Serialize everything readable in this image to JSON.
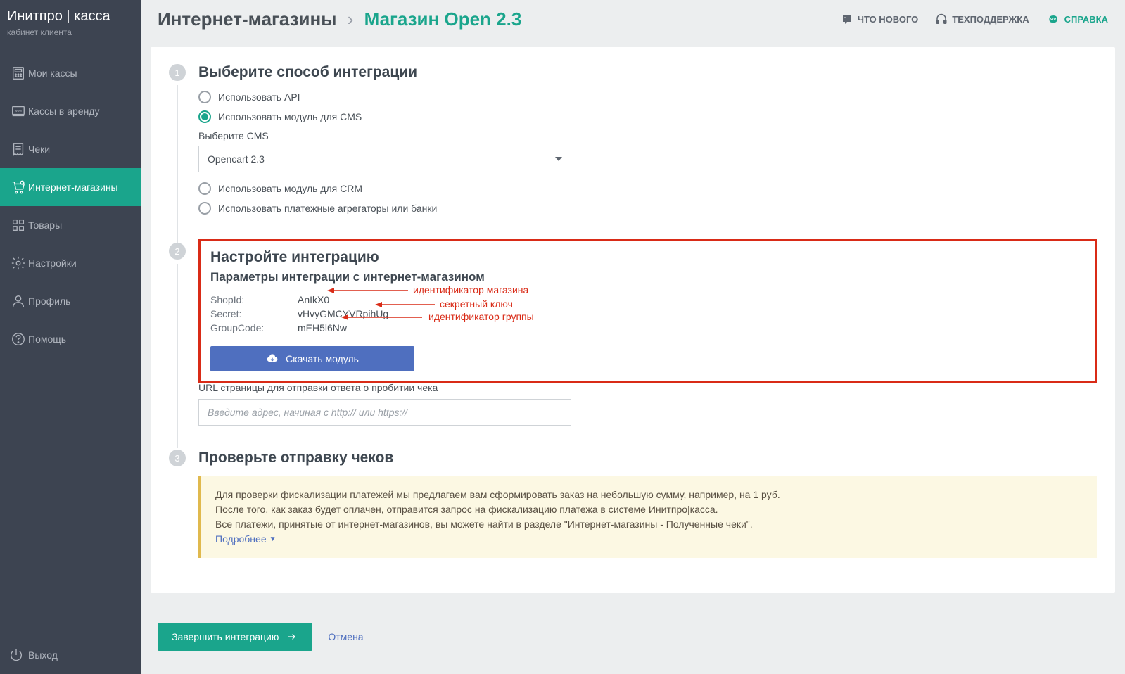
{
  "brand": {
    "name1": "Инитпро",
    "sep": " | ",
    "name2": "касса",
    "subtitle": "кабинет клиента"
  },
  "sidebar": {
    "items": [
      {
        "label": "Мои кассы"
      },
      {
        "label": "Кассы в аренду"
      },
      {
        "label": "Чеки"
      },
      {
        "label": "Интернет-магазины"
      },
      {
        "label": "Товары"
      },
      {
        "label": "Настройки"
      },
      {
        "label": "Профиль"
      },
      {
        "label": "Помощь"
      }
    ],
    "footer": {
      "label": "Выход"
    }
  },
  "header": {
    "breadcrumb_root": "Интернет-магазины",
    "breadcrumb_sep": "›",
    "breadcrumb_current": "Магазин Open 2.3",
    "links": {
      "news": "ЧТО НОВОГО",
      "support": "ТЕХПОДДЕРЖКА",
      "help": "СПРАВКА"
    }
  },
  "step1": {
    "num": "1",
    "title": "Выберите способ интеграции",
    "options": {
      "api": "Использовать API",
      "cms": "Использовать модуль для CMS",
      "crm": "Использовать модуль для CRM",
      "agg": "Использовать платежные агрегаторы или банки"
    },
    "cms_select_label": "Выберите CMS",
    "cms_selected": "Opencart 2.3"
  },
  "step2": {
    "num": "2",
    "title": "Настройте интеграцию",
    "subtitle": "Параметры интеграции с интернет-магазином",
    "params": {
      "shopid_label": "ShopId:",
      "shopid_value": "AnIkX0",
      "secret_label": "Secret:",
      "secret_value": "vHvyGMCYVRpihUg",
      "group_label": "GroupCode:",
      "group_value": "mEH5l6Nw"
    },
    "download": "Скачать модуль",
    "annotations": {
      "shopid": "идентификатор магазина",
      "secret": "секретный ключ",
      "group": "идентификатор группы"
    },
    "url_label": "URL страницы для отправки ответа о пробитии чека",
    "url_placeholder": "Введите адрес, начиная с http:// или https://"
  },
  "step3": {
    "num": "3",
    "title": "Проверьте отправку чеков",
    "alert_line1": "Для проверки фискализации платежей мы предлагаем вам сформировать заказ на небольшую сумму, например, на 1 руб.",
    "alert_line2": "После того, как заказ будет оплачен, отправится запрос на фискализацию платежа в системе Инитпро|касса.",
    "alert_line3": "Все платежи, принятые от интернет-магазинов, вы можете найти в разделе \"Интернет-магазины - Полученные чеки\".",
    "alert_more": "Подробнее"
  },
  "actions": {
    "finish": "Завершить интеграцию",
    "cancel": "Отмена"
  }
}
